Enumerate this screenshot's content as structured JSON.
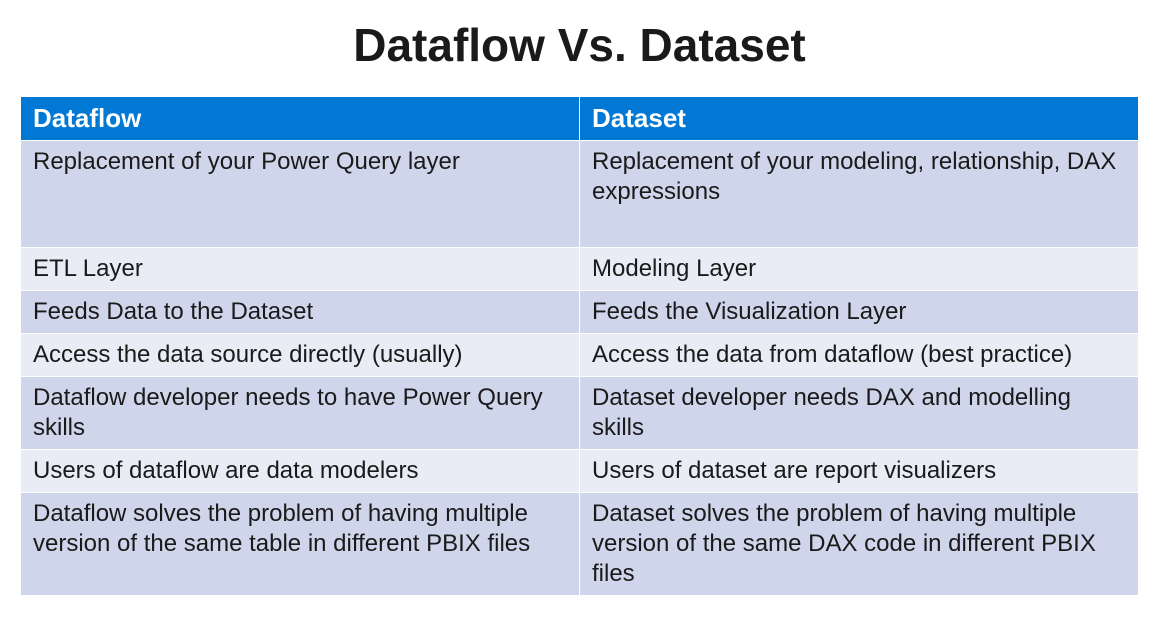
{
  "title": "Dataflow Vs. Dataset",
  "headers": {
    "left": "Dataflow",
    "right": "Dataset"
  },
  "rows": [
    {
      "left": "Replacement of your Power Query layer",
      "right": "Replacement of your modeling, relationship, DAX expressions"
    },
    {
      "left": "ETL Layer",
      "right": "Modeling Layer"
    },
    {
      "left": "Feeds Data to the Dataset",
      "right": "Feeds the Visualization Layer"
    },
    {
      "left": "Access the data source directly (usually)",
      "right": "Access the data from dataflow (best practice)"
    },
    {
      "left": "Dataflow developer needs to have Power Query skills",
      "right": "Dataset developer needs DAX and modelling skills"
    },
    {
      "left": "Users of dataflow are data modelers",
      "right": "Users of dataset are report visualizers"
    },
    {
      "left": "Dataflow solves the problem of having multiple version of the same table in different PBIX files",
      "right": "Dataset solves the problem of having multiple version of the same DAX code in different PBIX files"
    }
  ],
  "chart_data": {
    "type": "table",
    "title": "Dataflow Vs. Dataset",
    "columns": [
      "Dataflow",
      "Dataset"
    ],
    "rows": [
      [
        "Replacement of your Power Query layer",
        "Replacement of your modeling, relationship, DAX expressions"
      ],
      [
        "ETL Layer",
        "Modeling Layer"
      ],
      [
        "Feeds Data to the Dataset",
        "Feeds the Visualization Layer"
      ],
      [
        "Access the data source directly (usually)",
        "Access the data from dataflow (best practice)"
      ],
      [
        "Dataflow developer needs to have Power Query skills",
        "Dataset developer needs DAX and modelling skills"
      ],
      [
        "Users of dataflow are data modelers",
        "Users of dataset are report visualizers"
      ],
      [
        "Dataflow solves the problem of having multiple version of the same table in different PBIX files",
        "Dataset solves the problem of having multiple version of the same DAX code in different PBIX files"
      ]
    ]
  }
}
